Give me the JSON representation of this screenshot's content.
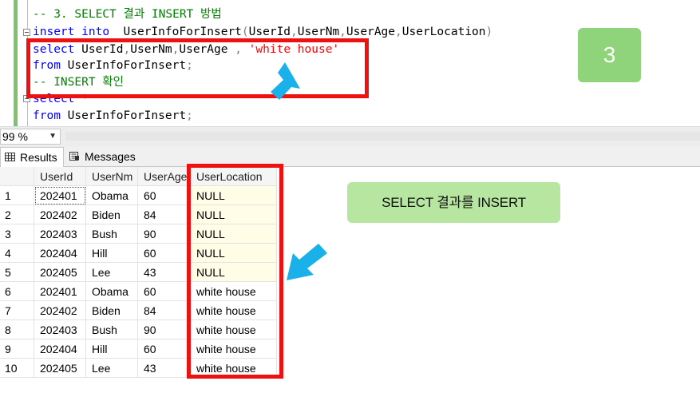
{
  "editor": {
    "lines": [
      {
        "parts": [
          {
            "t": "-- 3. SELECT 결과 INSERT 방법",
            "c": "cm"
          }
        ]
      },
      {
        "parts": [
          {
            "t": "insert",
            "c": "kw"
          },
          {
            "t": " ",
            "c": ""
          },
          {
            "t": "into",
            "c": "kw"
          },
          {
            "t": "  UserInfoForInsert",
            "c": ""
          },
          {
            "t": "(",
            "c": "gray"
          },
          {
            "t": "UserId",
            "c": ""
          },
          {
            "t": ",",
            "c": "gray"
          },
          {
            "t": "UserNm",
            "c": ""
          },
          {
            "t": ",",
            "c": "gray"
          },
          {
            "t": "UserAge",
            "c": ""
          },
          {
            "t": ",",
            "c": "gray"
          },
          {
            "t": "UserLocation",
            "c": ""
          },
          {
            "t": ")",
            "c": "gray"
          }
        ]
      },
      {
        "parts": [
          {
            "t": "select",
            "c": "kw"
          },
          {
            "t": " UserId",
            "c": ""
          },
          {
            "t": ",",
            "c": "gray"
          },
          {
            "t": "UserNm",
            "c": ""
          },
          {
            "t": ",",
            "c": "gray"
          },
          {
            "t": "UserAge ",
            "c": ""
          },
          {
            "t": ",",
            "c": "gray"
          },
          {
            "t": " ",
            "c": ""
          },
          {
            "t": "'white house'",
            "c": "str"
          }
        ]
      },
      {
        "parts": [
          {
            "t": "from",
            "c": "kw"
          },
          {
            "t": " UserInfoForInsert",
            "c": ""
          },
          {
            "t": ";",
            "c": "gray"
          }
        ]
      },
      {
        "parts": [
          {
            "t": "-- INSERT 확인",
            "c": "cm"
          }
        ]
      },
      {
        "parts": [
          {
            "t": "select",
            "c": "kw"
          },
          {
            "t": " *",
            "c": "gray"
          }
        ]
      },
      {
        "parts": [
          {
            "t": "from",
            "c": "kw"
          },
          {
            "t": " UserInfoForInsert",
            "c": ""
          },
          {
            "t": ";",
            "c": "gray"
          }
        ]
      }
    ]
  },
  "zoom": {
    "value": "99 %"
  },
  "tabs": {
    "results": "Results",
    "messages": "Messages"
  },
  "grid": {
    "columns": [
      "UserId",
      "UserNm",
      "UserAge",
      "UserLocation"
    ],
    "rows": [
      {
        "n": "1",
        "cells": [
          "202401",
          "Obama",
          "60",
          "NULL"
        ]
      },
      {
        "n": "2",
        "cells": [
          "202402",
          "Biden",
          "84",
          "NULL"
        ]
      },
      {
        "n": "3",
        "cells": [
          "202403",
          "Bush",
          "90",
          "NULL"
        ]
      },
      {
        "n": "4",
        "cells": [
          "202404",
          "Hill",
          "60",
          "NULL"
        ]
      },
      {
        "n": "5",
        "cells": [
          "202405",
          "Lee",
          "43",
          "NULL"
        ]
      },
      {
        "n": "6",
        "cells": [
          "202401",
          "Obama",
          "60",
          "white house"
        ]
      },
      {
        "n": "7",
        "cells": [
          "202402",
          "Biden",
          "84",
          "white house"
        ]
      },
      {
        "n": "8",
        "cells": [
          "202403",
          "Bush",
          "90",
          "white house"
        ]
      },
      {
        "n": "9",
        "cells": [
          "202404",
          "Hill",
          "60",
          "white house"
        ]
      },
      {
        "n": "10",
        "cells": [
          "202405",
          "Lee",
          "43",
          "white house"
        ]
      }
    ]
  },
  "annotations": {
    "step_badge": "3",
    "label": "SELECT 결과를 INSERT",
    "highlight_color": "#ee1111",
    "arrow_color": "#1ab0ea",
    "badge_color": "#8fd47a"
  }
}
